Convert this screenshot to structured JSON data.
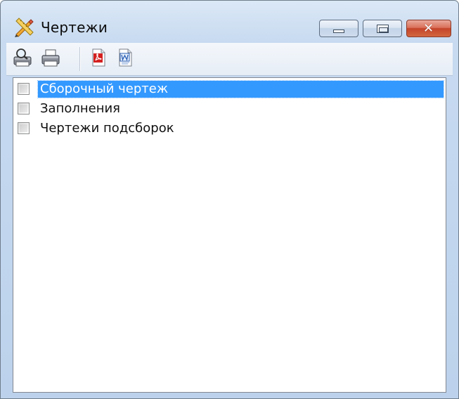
{
  "window": {
    "title": "Чертежи",
    "app_icon": "drafting-tools-icon"
  },
  "caption_buttons": {
    "minimize_icon": "minimize-icon",
    "maximize_icon": "maximize-icon",
    "close_icon": "close-icon",
    "close_glyph": "✕"
  },
  "toolbar": {
    "buttons": [
      {
        "icon": "print-preview-icon"
      },
      {
        "icon": "print-icon"
      },
      {
        "icon": "pdf-export-icon"
      },
      {
        "icon": "word-export-icon"
      }
    ]
  },
  "list": {
    "items": [
      {
        "label": "Сборочный чертеж",
        "checked": false,
        "selected": true
      },
      {
        "label": "Заполнения",
        "checked": false,
        "selected": false
      },
      {
        "label": "Чертежи подсборок",
        "checked": false,
        "selected": false
      }
    ]
  },
  "colors": {
    "selection": "#3399ff",
    "close_button": "#c5452a",
    "frame": "#bcd2ec"
  }
}
